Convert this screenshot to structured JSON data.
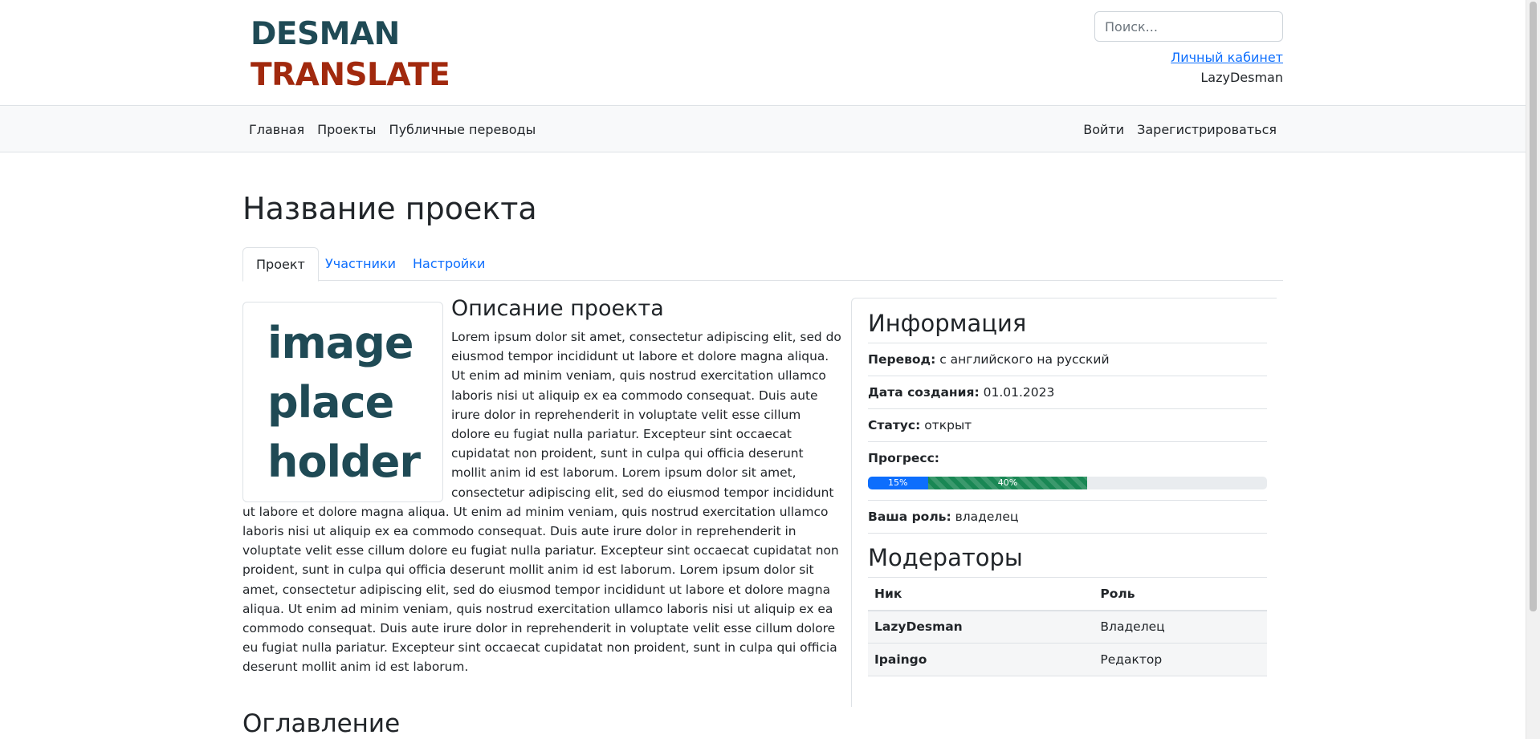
{
  "header": {
    "logo_line1": "DESMAN",
    "logo_line2": "TRANSLATE",
    "search_placeholder": "Поиск...",
    "cabinet_link": "Личный кабинет",
    "username": "LazyDesman"
  },
  "nav": {
    "left": [
      "Главная",
      "Проекты",
      "Публичные переводы"
    ],
    "right": [
      "Войти",
      "Зарегистрироваться"
    ]
  },
  "page": {
    "title": "Название проекта",
    "tabs": [
      "Проект",
      "Участники",
      "Настройки"
    ],
    "active_tab": "Проект"
  },
  "image_placeholder": [
    "image",
    "place",
    "holder"
  ],
  "description": {
    "title": "Описание проекта",
    "text": "Lorem ipsum dolor sit amet, consectetur adipiscing elit, sed do eiusmod tempor incididunt ut labore et dolore magna aliqua. Ut enim ad minim veniam, quis nostrud exercitation ullamco laboris nisi ut aliquip ex ea commodo consequat. Duis aute irure dolor in reprehenderit in voluptate velit esse cillum dolore eu fugiat nulla pariatur. Excepteur sint occaecat cupidatat non proident, sunt in culpa qui officia deserunt mollit anim id est laborum. Lorem ipsum dolor sit amet, consectetur adipiscing elit, sed do eiusmod tempor incididunt ut labore et dolore magna aliqua. Ut enim ad minim veniam, quis nostrud exercitation ullamco laboris nisi ut aliquip ex ea commodo consequat. Duis aute irure dolor in reprehenderit in voluptate velit esse cillum dolore eu fugiat nulla pariatur. Excepteur sint occaecat cupidatat non proident, sunt in culpa qui officia deserunt mollit anim id est laborum. Lorem ipsum dolor sit amet, consectetur adipiscing elit, sed do eiusmod tempor incididunt ut labore et dolore magna aliqua. Ut enim ad minim veniam, quis nostrud exercitation ullamco laboris nisi ut aliquip ex ea commodo consequat. Duis aute irure dolor in reprehenderit in voluptate velit esse cillum dolore eu fugiat nulla pariatur. Excepteur sint occaecat cupidatat non proident, sunt in culpa qui officia deserunt mollit anim id est laborum."
  },
  "toc": {
    "title": "Оглавление"
  },
  "info": {
    "title": "Информация",
    "translation_label": "Перевод:",
    "translation_value": "с английского на русский",
    "created_label": "Дата создания:",
    "created_value": "01.01.2023",
    "status_label": "Статус:",
    "status_value": "открыт",
    "progress_label": "Прогресс:",
    "progress": {
      "segment1": {
        "label": "15%",
        "value": 15,
        "color": "#0d6efd"
      },
      "segment2": {
        "label": "40%",
        "value": 40,
        "color": "#198754"
      }
    },
    "role_label": "Ваша роль:",
    "role_value": "владелец"
  },
  "moderators": {
    "title": "Модераторы",
    "columns": [
      "Ник",
      "Роль"
    ],
    "rows": [
      {
        "nick": "LazyDesman",
        "role": "Владелец"
      },
      {
        "nick": "Ipaingo",
        "role": "Редактор"
      }
    ]
  },
  "colors": {
    "logo_dark": "#1f4a55",
    "logo_red": "#a1290e",
    "link": "#0d6efd"
  }
}
